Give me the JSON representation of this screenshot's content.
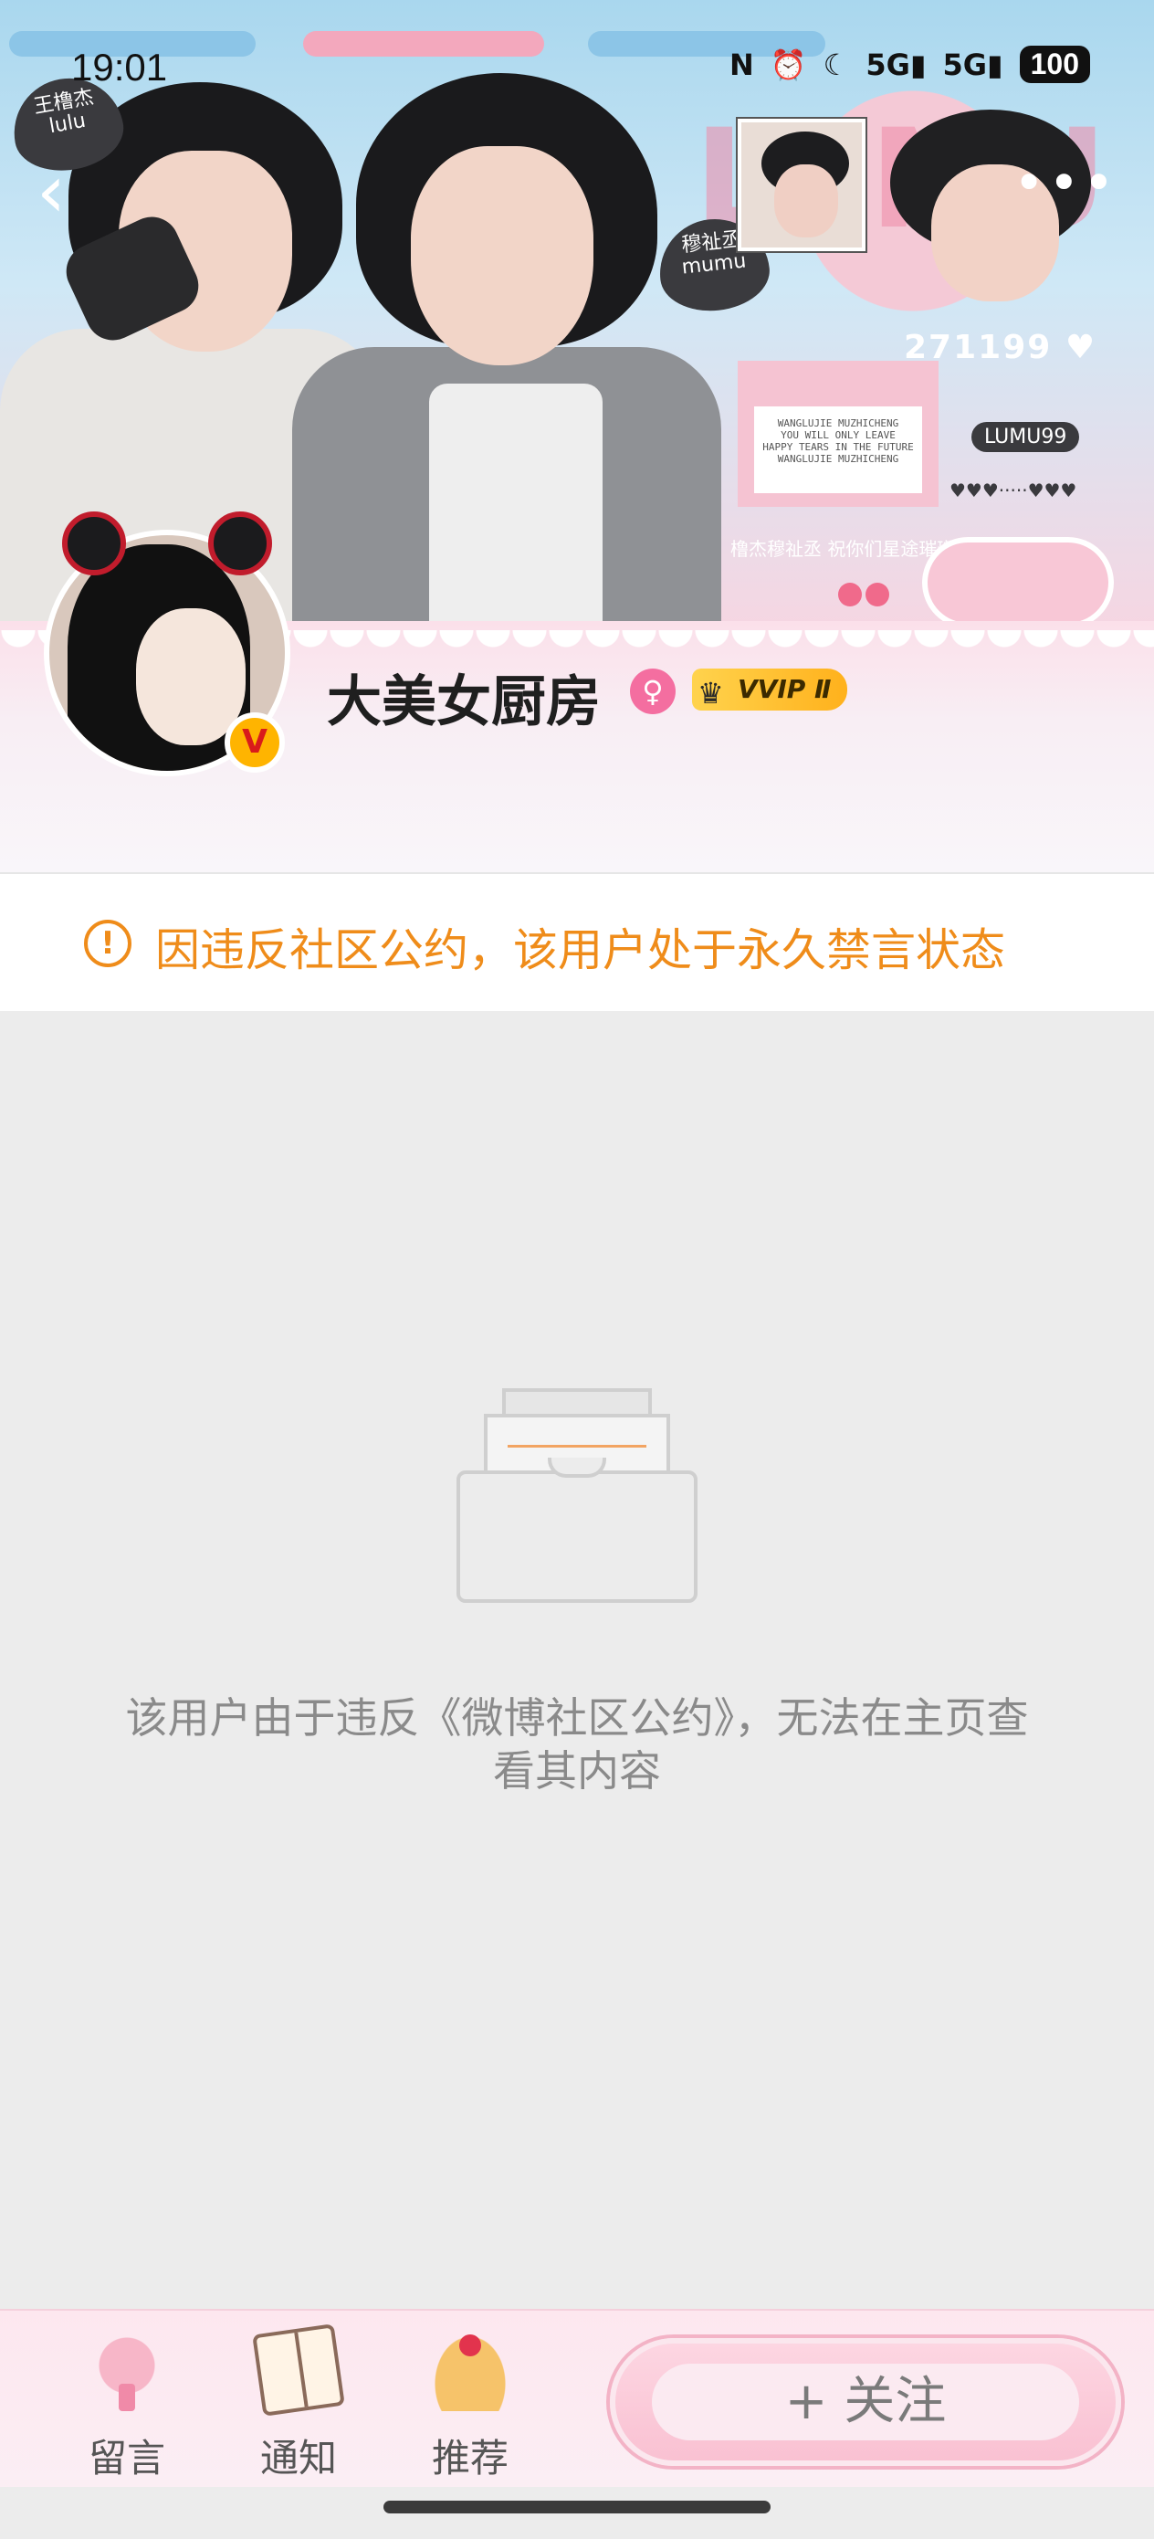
{
  "status_bar": {
    "time": "19:01",
    "battery": "100",
    "net1": "5G",
    "net2": "5G"
  },
  "banner": {
    "tag_left_line1": "王橹杰",
    "tag_left_line2": "lulu",
    "tag_right_line1": "穆祉丞",
    "tag_right_line2": "mumu",
    "number_text": "271199 ♥",
    "lumu_tag": "LUMU99",
    "sign_lines": [
      "WANGLUJIE MUZHICHENG",
      "YOU WILL ONLY LEAVE",
      "HAPPY TEARS IN THE FUTURE",
      "WANGLUJIE MUZHICHENG"
    ],
    "bottom_line": "橹杰穆祉丞 祝你们星途璀璨",
    "dots": "♥♥♥·····♥♥♥"
  },
  "profile": {
    "username": "大美女厨房",
    "vip_label": "VVIP Ⅱ",
    "verified_mark": "V",
    "gender_symbol": "♀"
  },
  "notice": {
    "icon_symbol": "!",
    "text": "因违反社区公约，该用户处于永久禁言状态",
    "color": "#ef8c1a"
  },
  "empty_state": {
    "message": "该用户由于违反《微博社区公约》，无法在主页查看其内容"
  },
  "bottom_bar": {
    "items": [
      {
        "label": "留言",
        "icon": "dessert-cup-icon"
      },
      {
        "label": "通知",
        "icon": "book-icon"
      },
      {
        "label": "推荐",
        "icon": "pudding-icon"
      }
    ],
    "follow_label": "+ 关注"
  },
  "icons": {
    "back": "‹",
    "more": "•••"
  }
}
